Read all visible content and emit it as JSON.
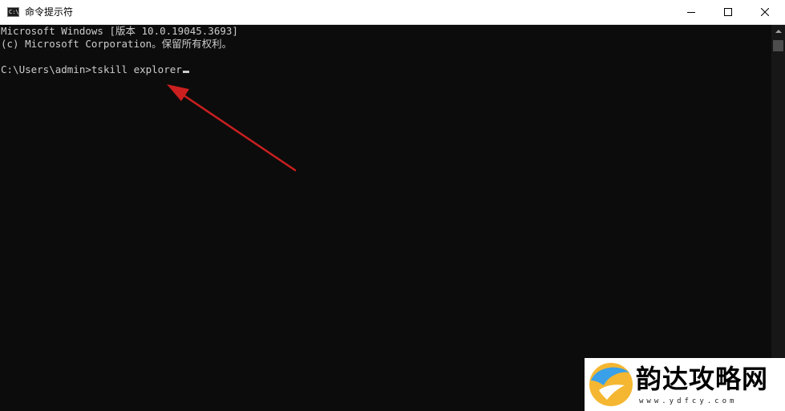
{
  "window": {
    "title": "命令提示符",
    "icon": "cmd-icon",
    "icon_glyph": "C:\\",
    "controls": [
      "minimize",
      "maximize",
      "close"
    ]
  },
  "console": {
    "line1": "Microsoft Windows [版本 10.0.19045.3693]",
    "line2": "(c) Microsoft Corporation。保留所有权利。",
    "prompt": "C:\\Users\\admin>",
    "command": "tskill explorer"
  },
  "annotation": {
    "type": "arrow",
    "color": "#cc1f1f"
  },
  "watermark": {
    "name": "韵达攻略网",
    "url": "www.ydfcy.com",
    "logo_colors": [
      "#3aa0e8",
      "#f5b731"
    ]
  },
  "colors": {
    "console_bg": "#0c0c0c",
    "console_text": "#cccccc",
    "titlebar_bg": "#ffffff"
  }
}
